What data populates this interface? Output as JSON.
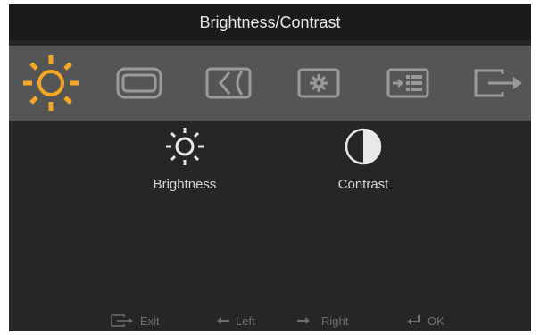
{
  "header": {
    "title": "Brightness/Contrast"
  },
  "tabs": [
    {
      "name": "brightness-contrast",
      "icon": "sun-icon",
      "active": true
    },
    {
      "name": "image-position",
      "icon": "image-position-icon"
    },
    {
      "name": "image-setup",
      "icon": "image-setup-icon"
    },
    {
      "name": "image-properties",
      "icon": "settings-icon"
    },
    {
      "name": "options",
      "icon": "options-list-icon"
    },
    {
      "name": "exit",
      "icon": "exit-icon"
    }
  ],
  "options": [
    {
      "label": "Brightness",
      "icon": "sun-icon"
    },
    {
      "label": "Contrast",
      "icon": "half-circle-icon"
    }
  ],
  "footer": {
    "exit": "Exit",
    "left": "Left",
    "right": "Right",
    "ok": "OK"
  },
  "colors": {
    "accent": "#f5a623",
    "icon": "#9a9a9a",
    "panel": "#262626",
    "tabbar": "#555555"
  }
}
